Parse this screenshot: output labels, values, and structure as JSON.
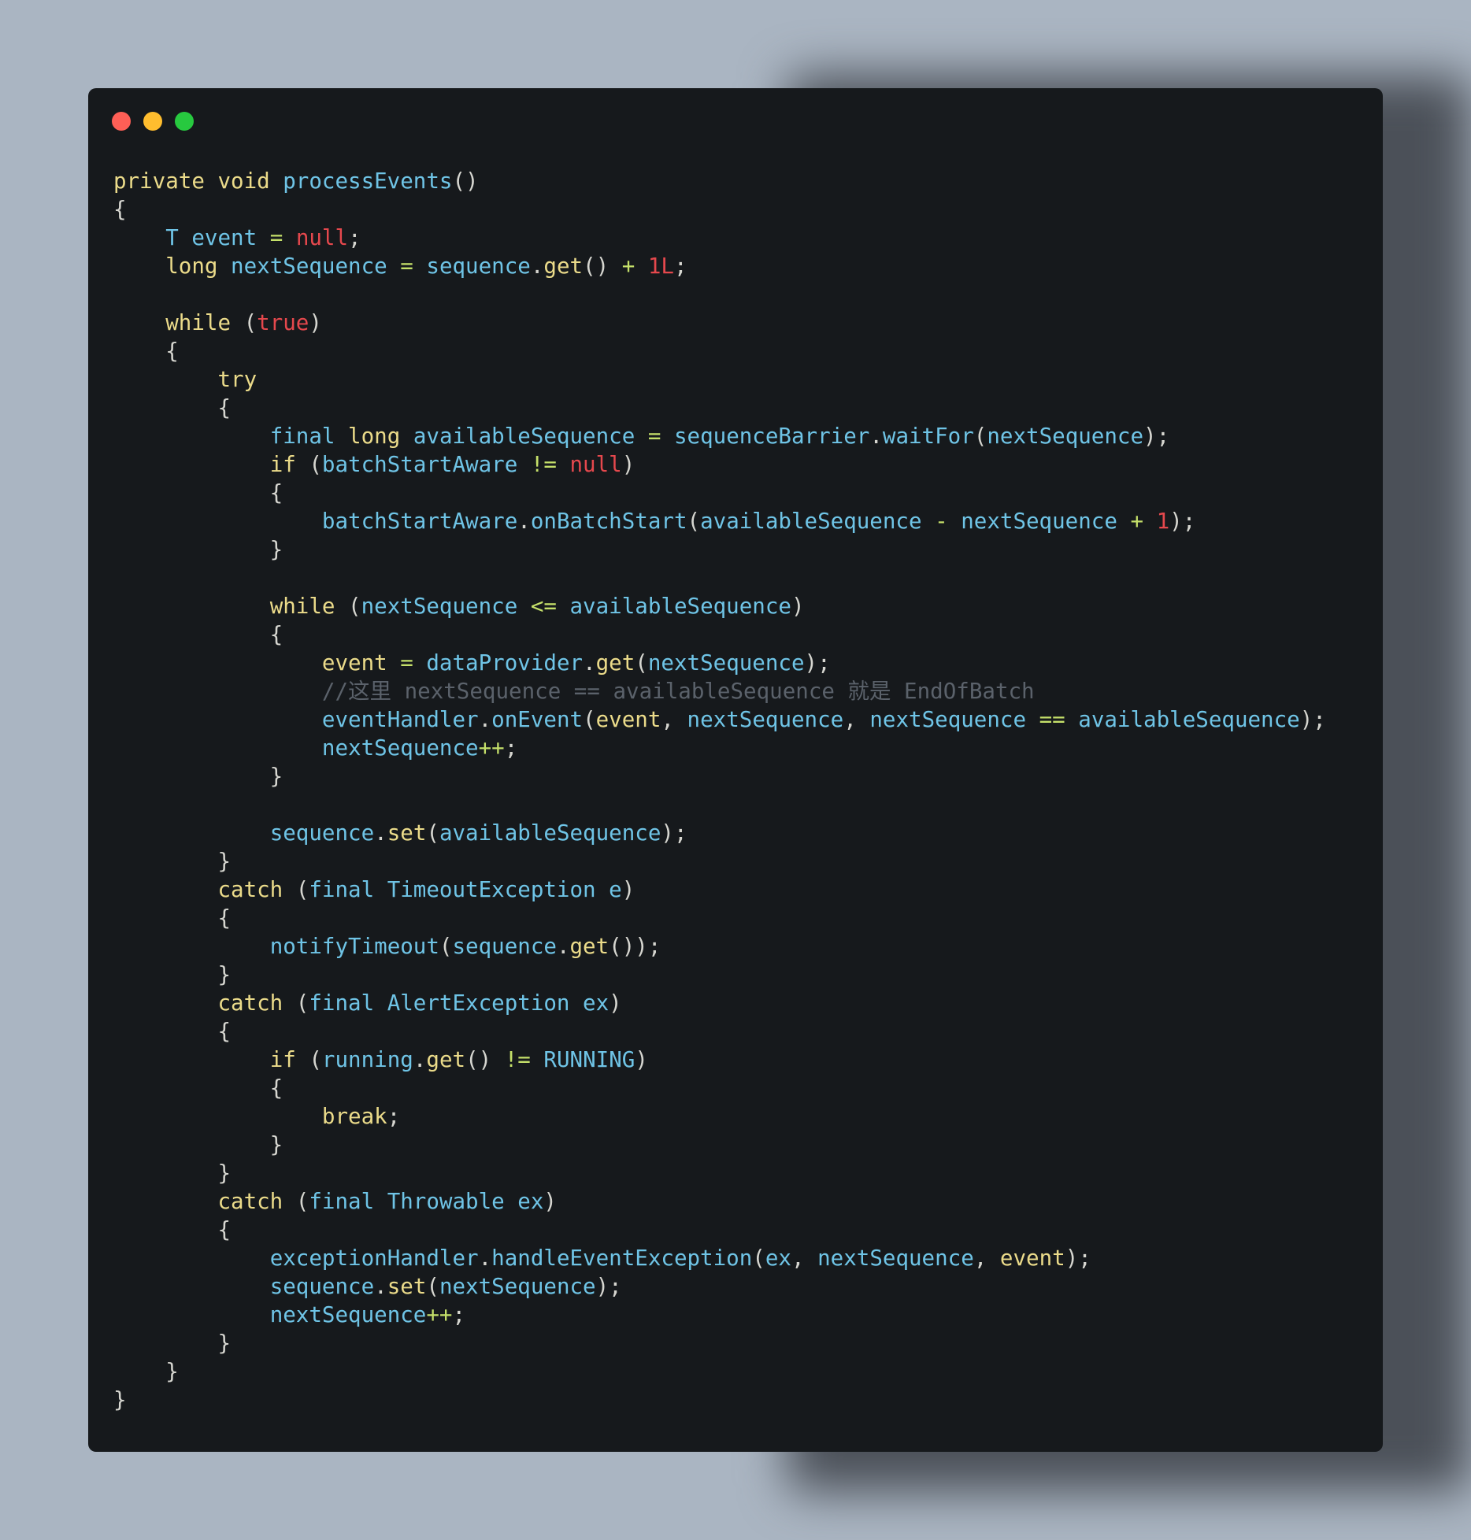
{
  "window": {
    "traffic_lights": [
      {
        "name": "close-light",
        "color": "#ff5f56"
      },
      {
        "name": "minimize-light",
        "color": "#ffbd2e"
      },
      {
        "name": "maximize-light",
        "color": "#27c93f"
      }
    ]
  },
  "colors": {
    "background": "#aab5c2",
    "window": "#16191c",
    "plain": "#d6d6d0",
    "keyword": "#ebdb8a",
    "identifier": "#6fc4e6",
    "literal": "#e5484d",
    "operator": "#c5e06a",
    "comment": "#5b626b"
  },
  "code": {
    "lines": [
      [
        [
          "keyword",
          "private void "
        ],
        [
          "identifier",
          "processEvents"
        ],
        [
          "plain",
          "()"
        ]
      ],
      [
        [
          "plain",
          "{"
        ]
      ],
      [
        [
          "plain",
          "    "
        ],
        [
          "identifier",
          "T event "
        ],
        [
          "operator",
          "= "
        ],
        [
          "literal",
          "null"
        ],
        [
          "plain",
          ";"
        ]
      ],
      [
        [
          "plain",
          "    "
        ],
        [
          "keyword",
          "long "
        ],
        [
          "identifier",
          "nextSequence "
        ],
        [
          "operator",
          "= "
        ],
        [
          "identifier",
          "sequence"
        ],
        [
          "plain",
          "."
        ],
        [
          "keyword",
          "get"
        ],
        [
          "plain",
          "() "
        ],
        [
          "operator",
          "+ "
        ],
        [
          "literal",
          "1L"
        ],
        [
          "plain",
          ";"
        ]
      ],
      [],
      [
        [
          "plain",
          "    "
        ],
        [
          "keyword",
          "while "
        ],
        [
          "plain",
          "("
        ],
        [
          "literal",
          "true"
        ],
        [
          "plain",
          ")"
        ]
      ],
      [
        [
          "plain",
          "    {"
        ]
      ],
      [
        [
          "plain",
          "        "
        ],
        [
          "keyword",
          "try"
        ]
      ],
      [
        [
          "plain",
          "        {"
        ]
      ],
      [
        [
          "plain",
          "            "
        ],
        [
          "identifier",
          "final "
        ],
        [
          "keyword",
          "long "
        ],
        [
          "identifier",
          "availableSequence "
        ],
        [
          "operator",
          "= "
        ],
        [
          "identifier",
          "sequenceBarrier"
        ],
        [
          "plain",
          "."
        ],
        [
          "identifier",
          "waitFor"
        ],
        [
          "plain",
          "("
        ],
        [
          "identifier",
          "nextSequence"
        ],
        [
          "plain",
          ");"
        ]
      ],
      [
        [
          "plain",
          "            "
        ],
        [
          "keyword",
          "if "
        ],
        [
          "plain",
          "("
        ],
        [
          "identifier",
          "batchStartAware "
        ],
        [
          "operator",
          "!= "
        ],
        [
          "literal",
          "null"
        ],
        [
          "plain",
          ")"
        ]
      ],
      [
        [
          "plain",
          "            {"
        ]
      ],
      [
        [
          "plain",
          "                "
        ],
        [
          "identifier",
          "batchStartAware"
        ],
        [
          "plain",
          "."
        ],
        [
          "identifier",
          "onBatchStart"
        ],
        [
          "plain",
          "("
        ],
        [
          "identifier",
          "availableSequence "
        ],
        [
          "operator",
          "- "
        ],
        [
          "identifier",
          "nextSequence "
        ],
        [
          "operator",
          "+ "
        ],
        [
          "literal",
          "1"
        ],
        [
          "plain",
          ");"
        ]
      ],
      [
        [
          "plain",
          "            }"
        ]
      ],
      [],
      [
        [
          "plain",
          "            "
        ],
        [
          "keyword",
          "while "
        ],
        [
          "plain",
          "("
        ],
        [
          "identifier",
          "nextSequence "
        ],
        [
          "operator",
          "<= "
        ],
        [
          "identifier",
          "availableSequence"
        ],
        [
          "plain",
          ")"
        ]
      ],
      [
        [
          "plain",
          "            {"
        ]
      ],
      [
        [
          "plain",
          "                "
        ],
        [
          "keyword",
          "event "
        ],
        [
          "operator",
          "= "
        ],
        [
          "identifier",
          "dataProvider"
        ],
        [
          "plain",
          "."
        ],
        [
          "keyword",
          "get"
        ],
        [
          "plain",
          "("
        ],
        [
          "identifier",
          "nextSequence"
        ],
        [
          "plain",
          ");"
        ]
      ],
      [
        [
          "plain",
          "                "
        ],
        [
          "comment",
          "//这里 nextSequence == availableSequence 就是 EndOfBatch"
        ]
      ],
      [
        [
          "plain",
          "                "
        ],
        [
          "identifier",
          "eventHandler"
        ],
        [
          "plain",
          "."
        ],
        [
          "identifier",
          "onEvent"
        ],
        [
          "plain",
          "("
        ],
        [
          "keyword",
          "event"
        ],
        [
          "plain",
          ", "
        ],
        [
          "identifier",
          "nextSequence"
        ],
        [
          "plain",
          ", "
        ],
        [
          "identifier",
          "nextSequence "
        ],
        [
          "operator",
          "== "
        ],
        [
          "identifier",
          "availableSequence"
        ],
        [
          "plain",
          ");"
        ]
      ],
      [
        [
          "plain",
          "                "
        ],
        [
          "identifier",
          "nextSequence"
        ],
        [
          "operator",
          "++"
        ],
        [
          "plain",
          ";"
        ]
      ],
      [
        [
          "plain",
          "            }"
        ]
      ],
      [],
      [
        [
          "plain",
          "            "
        ],
        [
          "identifier",
          "sequence"
        ],
        [
          "plain",
          "."
        ],
        [
          "keyword",
          "set"
        ],
        [
          "plain",
          "("
        ],
        [
          "identifier",
          "availableSequence"
        ],
        [
          "plain",
          ");"
        ]
      ],
      [
        [
          "plain",
          "        }"
        ]
      ],
      [
        [
          "plain",
          "        "
        ],
        [
          "keyword",
          "catch "
        ],
        [
          "plain",
          "("
        ],
        [
          "identifier",
          "final TimeoutException e"
        ],
        [
          "plain",
          ")"
        ]
      ],
      [
        [
          "plain",
          "        {"
        ]
      ],
      [
        [
          "plain",
          "            "
        ],
        [
          "identifier",
          "notifyTimeout"
        ],
        [
          "plain",
          "("
        ],
        [
          "identifier",
          "sequence"
        ],
        [
          "plain",
          "."
        ],
        [
          "keyword",
          "get"
        ],
        [
          "plain",
          "());"
        ]
      ],
      [
        [
          "plain",
          "        }"
        ]
      ],
      [
        [
          "plain",
          "        "
        ],
        [
          "keyword",
          "catch "
        ],
        [
          "plain",
          "("
        ],
        [
          "identifier",
          "final AlertException ex"
        ],
        [
          "plain",
          ")"
        ]
      ],
      [
        [
          "plain",
          "        {"
        ]
      ],
      [
        [
          "plain",
          "            "
        ],
        [
          "keyword",
          "if "
        ],
        [
          "plain",
          "("
        ],
        [
          "identifier",
          "running"
        ],
        [
          "plain",
          "."
        ],
        [
          "keyword",
          "get"
        ],
        [
          "plain",
          "() "
        ],
        [
          "operator",
          "!= "
        ],
        [
          "identifier",
          "RUNNING"
        ],
        [
          "plain",
          ")"
        ]
      ],
      [
        [
          "plain",
          "            {"
        ]
      ],
      [
        [
          "plain",
          "                "
        ],
        [
          "keyword",
          "break"
        ],
        [
          "plain",
          ";"
        ]
      ],
      [
        [
          "plain",
          "            }"
        ]
      ],
      [
        [
          "plain",
          "        }"
        ]
      ],
      [
        [
          "plain",
          "        "
        ],
        [
          "keyword",
          "catch "
        ],
        [
          "plain",
          "("
        ],
        [
          "identifier",
          "final Throwable ex"
        ],
        [
          "plain",
          ")"
        ]
      ],
      [
        [
          "plain",
          "        {"
        ]
      ],
      [
        [
          "plain",
          "            "
        ],
        [
          "identifier",
          "exceptionHandler"
        ],
        [
          "plain",
          "."
        ],
        [
          "identifier",
          "handleEventException"
        ],
        [
          "plain",
          "("
        ],
        [
          "identifier",
          "ex"
        ],
        [
          "plain",
          ", "
        ],
        [
          "identifier",
          "nextSequence"
        ],
        [
          "plain",
          ", "
        ],
        [
          "keyword",
          "event"
        ],
        [
          "plain",
          ");"
        ]
      ],
      [
        [
          "plain",
          "            "
        ],
        [
          "identifier",
          "sequence"
        ],
        [
          "plain",
          "."
        ],
        [
          "keyword",
          "set"
        ],
        [
          "plain",
          "("
        ],
        [
          "identifier",
          "nextSequence"
        ],
        [
          "plain",
          ");"
        ]
      ],
      [
        [
          "plain",
          "            "
        ],
        [
          "identifier",
          "nextSequence"
        ],
        [
          "operator",
          "++"
        ],
        [
          "plain",
          ";"
        ]
      ],
      [
        [
          "plain",
          "        }"
        ]
      ],
      [
        [
          "plain",
          "    }"
        ]
      ],
      [
        [
          "plain",
          "}"
        ]
      ]
    ]
  }
}
